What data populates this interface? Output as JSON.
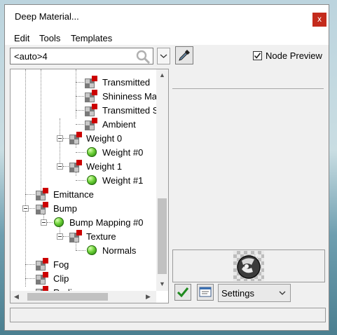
{
  "window": {
    "title": "Deep Material...",
    "close_label": "x"
  },
  "menu": {
    "items": [
      "Edit",
      "Tools",
      "Templates"
    ]
  },
  "toolbar": {
    "combo_value": "<auto>4",
    "node_preview_label": "Node Preview",
    "node_preview_checked": true
  },
  "tree": {
    "rows": [
      {
        "label": "Transmitted",
        "icon": "texture-icon"
      },
      {
        "label": "Shininess Ma",
        "icon": "texture-icon"
      },
      {
        "label": "Transmitted S",
        "icon": "texture-icon"
      },
      {
        "label": "Ambient",
        "icon": "texture-icon"
      },
      {
        "label": "Weight 0",
        "icon": "texture-icon"
      },
      {
        "label": "Weight #0",
        "icon": "sphere-icon"
      },
      {
        "label": "Weight 1",
        "icon": "texture-icon"
      },
      {
        "label": "Weight #1",
        "icon": "sphere-icon"
      },
      {
        "label": "Emittance",
        "icon": "texture-icon"
      },
      {
        "label": "Bump",
        "icon": "texture-icon"
      },
      {
        "label": "Bump Mapping #0",
        "icon": "sphere-icon"
      },
      {
        "label": "Texture",
        "icon": "texture-icon"
      },
      {
        "label": "Normals",
        "icon": "sphere-icon"
      },
      {
        "label": "Fog",
        "icon": "texture-icon"
      },
      {
        "label": "Clip",
        "icon": "texture-icon"
      },
      {
        "label": "Radiance",
        "icon": "texture-icon"
      }
    ]
  },
  "bottom": {
    "settings_label": "Settings"
  },
  "colors": {
    "accent_close": "#c42b1c",
    "sphere_green": "#4cbb24",
    "texture_red": "#cc0000"
  }
}
